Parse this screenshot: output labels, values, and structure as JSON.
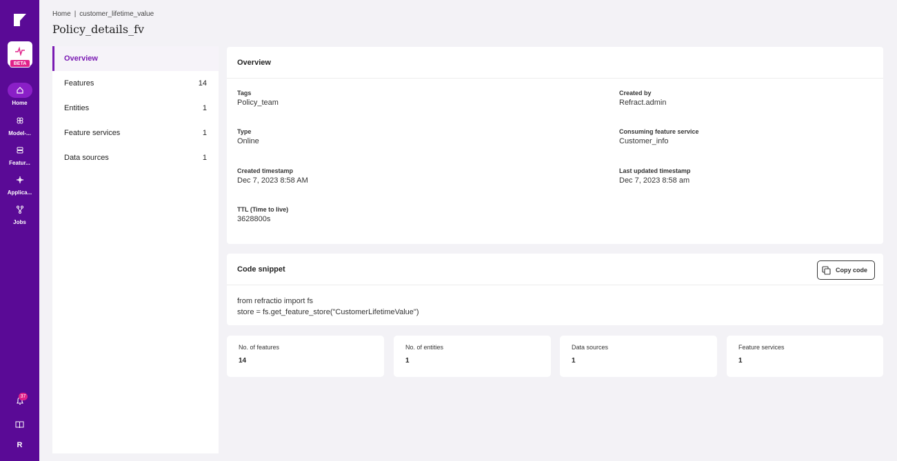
{
  "rail": {
    "beta": "BETA",
    "nav": [
      {
        "label": "Home",
        "icon": "home-icon"
      },
      {
        "label": "Model-...",
        "icon": "models-icon"
      },
      {
        "label": "Featur...",
        "icon": "feature-store-icon"
      },
      {
        "label": "Applica...",
        "icon": "applications-icon"
      },
      {
        "label": "Jobs",
        "icon": "jobs-icon"
      }
    ],
    "notifications_count": "37",
    "avatar_initial": "R"
  },
  "breadcrumb": {
    "home": "Home",
    "separator": "|",
    "current": "customer_lifetime_value"
  },
  "page_title": "Policy_details_fv",
  "subnav": [
    {
      "label": "Overview",
      "count": ""
    },
    {
      "label": "Features",
      "count": "14"
    },
    {
      "label": "Entities",
      "count": "1"
    },
    {
      "label": "Feature services",
      "count": "1"
    },
    {
      "label": "Data sources",
      "count": "1"
    }
  ],
  "overview": {
    "title": "Overview",
    "fields": [
      {
        "key": "Tags",
        "value": "Policy_team"
      },
      {
        "key": "Created by",
        "value": "Refract.admin"
      },
      {
        "key": "Type",
        "value": "Online"
      },
      {
        "key": "Consuming feature service",
        "value": "Customer_info"
      },
      {
        "key": "Created timestamp",
        "value": "Dec 7, 2023 8:58 AM"
      },
      {
        "key": "Last updated timestamp",
        "value": "Dec 7, 2023 8:58 am"
      },
      {
        "key": "TTL (Time to live)",
        "value": "3628800s"
      }
    ]
  },
  "snippet": {
    "title": "Code snippet",
    "copy_label": "Copy code",
    "lines": [
      "from refractio import fs",
      "store = fs.get_feature_store(\"CustomerLifetimeValue\")"
    ]
  },
  "stats": [
    {
      "label": "No. of features",
      "value": "14"
    },
    {
      "label": "No. of entities",
      "value": "1"
    },
    {
      "label": "Data sources",
      "value": "1"
    },
    {
      "label": "Feature services",
      "value": "1"
    }
  ],
  "colors": {
    "rail": "#5a0a96",
    "accent": "#7a1ab3",
    "badge": "#e0218a"
  }
}
